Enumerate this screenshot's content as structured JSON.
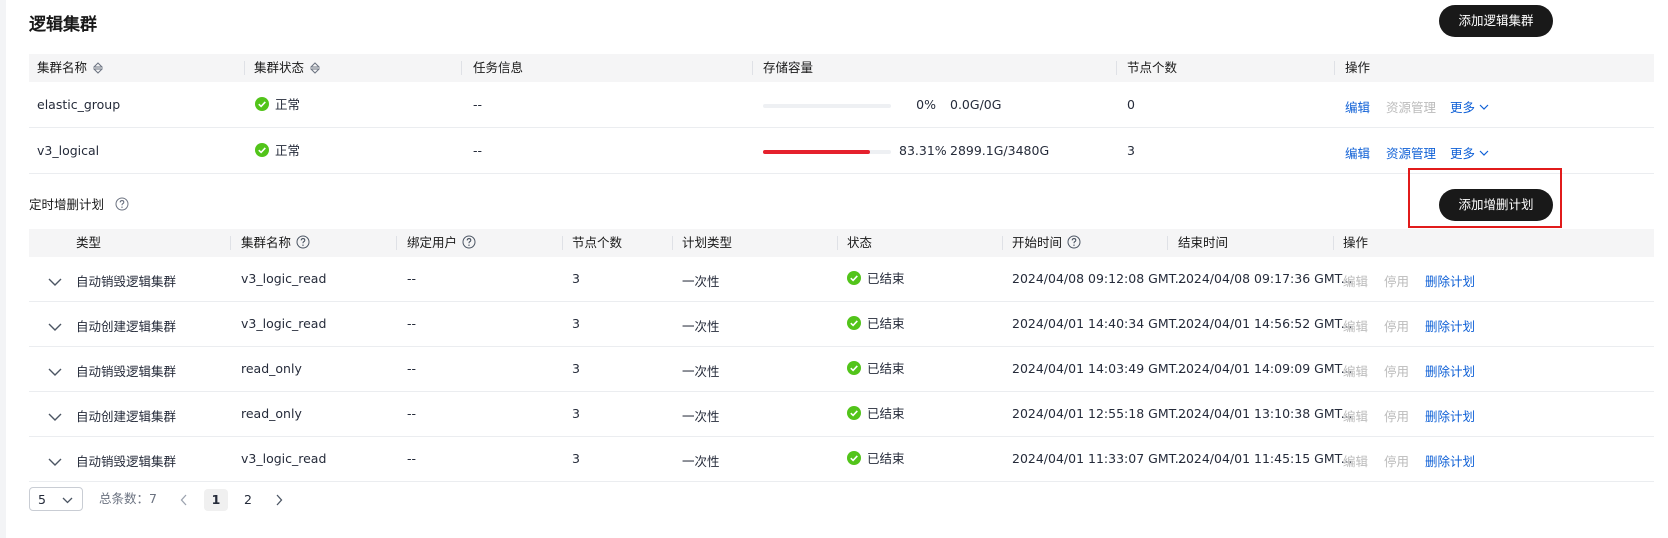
{
  "title": "逻辑集群",
  "add_cluster_button": "添加逻辑集群",
  "cluster_table": {
    "headers": [
      "集群名称",
      "集群状态",
      "任务信息",
      "存储容量",
      "节点个数",
      "操作"
    ],
    "rows": [
      {
        "name": "elastic_group",
        "status": "正常",
        "task": "--",
        "progress": 0,
        "percent": "0%",
        "capacity": "0.0G/0G",
        "nodes": "0",
        "actions": {
          "edit": "编辑",
          "resource": "资源管理",
          "more": "更多"
        },
        "resource_enabled": false
      },
      {
        "name": "v3_logical",
        "status": "正常",
        "task": "--",
        "progress": 0.8331,
        "percent": "83.31%",
        "capacity": "2899.1G/3480G",
        "nodes": "3",
        "actions": {
          "edit": "编辑",
          "resource": "资源管理",
          "more": "更多"
        },
        "resource_enabled": true
      }
    ]
  },
  "schedule_section_label": "定时增删计划",
  "add_schedule_button": "添加增删计划",
  "schedule_table": {
    "headers": [
      "类型",
      "集群名称",
      "绑定用户",
      "节点个数",
      "计划类型",
      "状态",
      "开始时间",
      "结束时间",
      "操作"
    ],
    "rows": [
      {
        "type": "自动销毁逻辑集群",
        "cluster": "v3_logic_read",
        "user": "--",
        "nodes": "3",
        "plan": "一次性",
        "status": "已结束",
        "start": "2024/04/08 09:12:08 GMT...",
        "end": "2024/04/08 09:17:36 GMT...",
        "edit": "编辑",
        "disable": "停用",
        "delete": "删除计划"
      },
      {
        "type": "自动创建逻辑集群",
        "cluster": "v3_logic_read",
        "user": "--",
        "nodes": "3",
        "plan": "一次性",
        "status": "已结束",
        "start": "2024/04/01 14:40:34 GMT...",
        "end": "2024/04/01 14:56:52 GMT...",
        "edit": "编辑",
        "disable": "停用",
        "delete": "删除计划"
      },
      {
        "type": "自动销毁逻辑集群",
        "cluster": "read_only",
        "user": "--",
        "nodes": "3",
        "plan": "一次性",
        "status": "已结束",
        "start": "2024/04/01 14:03:49 GMT...",
        "end": "2024/04/01 14:09:09 GMT...",
        "edit": "编辑",
        "disable": "停用",
        "delete": "删除计划"
      },
      {
        "type": "自动创建逻辑集群",
        "cluster": "read_only",
        "user": "--",
        "nodes": "3",
        "plan": "一次性",
        "status": "已结束",
        "start": "2024/04/01 12:55:18 GMT...",
        "end": "2024/04/01 13:10:38 GMT...",
        "edit": "编辑",
        "disable": "停用",
        "delete": "删除计划"
      },
      {
        "type": "自动销毁逻辑集群",
        "cluster": "v3_logic_read",
        "user": "--",
        "nodes": "3",
        "plan": "一次性",
        "status": "已结束",
        "start": "2024/04/01 11:33:07 GMT...",
        "end": "2024/04/01 11:45:15 GMT...",
        "edit": "编辑",
        "disable": "停用",
        "delete": "删除计划"
      }
    ]
  },
  "pagination": {
    "page_size": "5",
    "total": "总条数：7",
    "pages": [
      "1",
      "2"
    ],
    "current": "1"
  },
  "colors": {
    "accent": "#0f60d6",
    "success": "#52c41a",
    "danger": "#e5212d",
    "button": "#191919",
    "highlight": "#e11b1b"
  },
  "icons": [
    "ok-icon",
    "sort-icon",
    "help-icon",
    "chevron-down-icon",
    "expand-icon",
    "chevron-left-icon",
    "chevron-right-icon"
  ]
}
